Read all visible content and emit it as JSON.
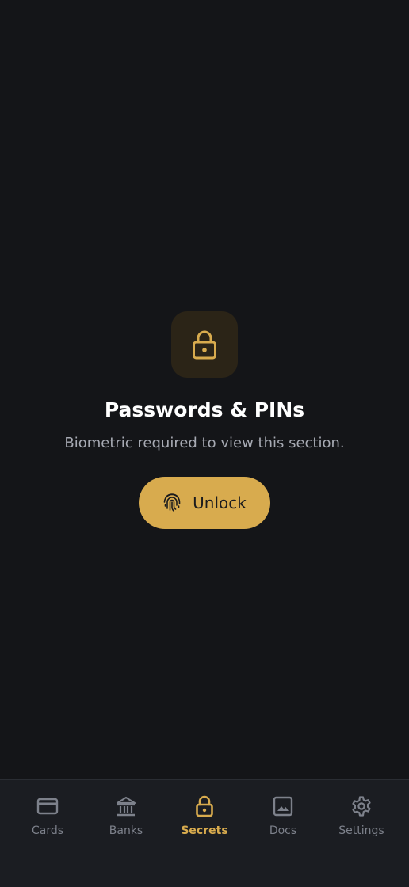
{
  "lock_screen": {
    "title": "Passwords & PINs",
    "subtitle": "Biometric required to view this section.",
    "unlock_button": {
      "label": "Unlock",
      "icon": "fingerprint-icon"
    },
    "badge_icon": "lock-icon"
  },
  "bottom_nav": {
    "active": "Secrets",
    "items": [
      {
        "label": "Cards",
        "icon": "credit-card-icon"
      },
      {
        "label": "Banks",
        "icon": "bank-icon"
      },
      {
        "label": "Secrets",
        "icon": "lock-icon"
      },
      {
        "label": "Docs",
        "icon": "image-icon"
      },
      {
        "label": "Settings",
        "icon": "gear-icon"
      }
    ]
  },
  "colors": {
    "background": "#141518",
    "accent": "#d8ab4e",
    "nav_background": "#1b1d22",
    "inactive": "#7d818b"
  }
}
